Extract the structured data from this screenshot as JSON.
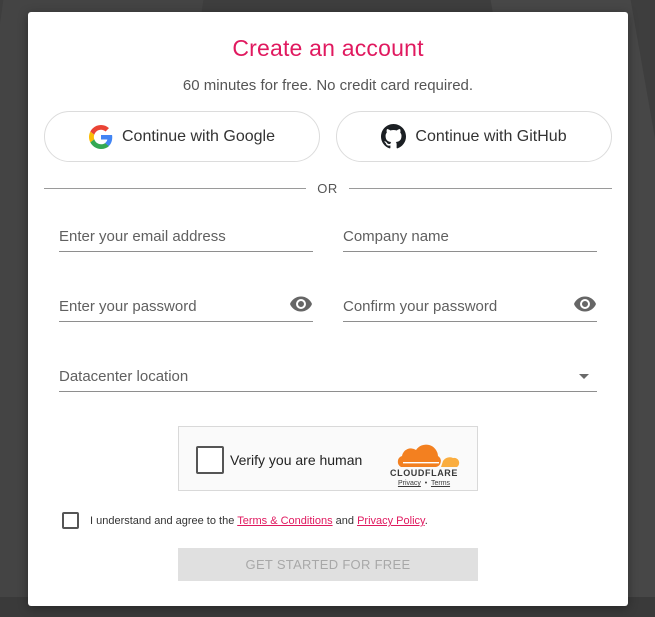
{
  "header": {
    "title": "Create an account",
    "subtitle": "60 minutes for free. No credit card required."
  },
  "sso": {
    "google_label": "Continue with Google",
    "github_label": "Continue with GitHub"
  },
  "divider_label": "OR",
  "form": {
    "email_placeholder": "Enter your email address",
    "company_placeholder": "Company name",
    "password_placeholder": "Enter your password",
    "confirm_placeholder": "Confirm your password",
    "datacenter_label": "Datacenter location"
  },
  "captcha": {
    "label": "Verify you are human",
    "brand": "CLOUDFLARE",
    "privacy": "Privacy",
    "separator": "•",
    "terms": "Terms"
  },
  "agreement": {
    "prefix": "I understand and agree to the",
    "terms_link": "Terms & Conditions",
    "and": "and",
    "privacy_link": "Privacy Policy",
    "suffix": "."
  },
  "submit_label": "GET STARTED FOR FREE",
  "colors": {
    "accent": "#e0195f",
    "background": "#3e3e3e",
    "cloudflare_orange": "#f38020"
  },
  "icons": {
    "google": "google-logo-icon",
    "github": "github-logo-icon",
    "visibility": "eye-icon",
    "dropdown": "caret-down-icon"
  }
}
